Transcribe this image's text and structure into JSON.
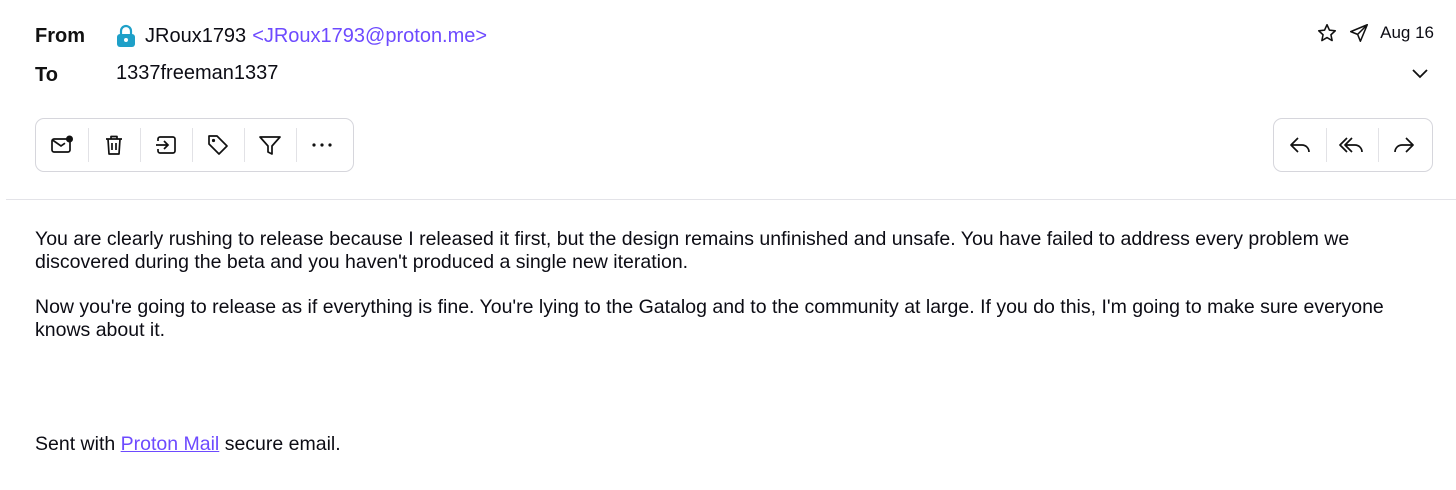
{
  "header": {
    "from_label": "From",
    "to_label": "To",
    "sender_name": "JRoux1793",
    "sender_email": "<JRoux1793@proton.me>",
    "recipient": "1337freeman1337",
    "date": "Aug 16"
  },
  "toolbar_left": [
    {
      "icon": "mark-unread-icon"
    },
    {
      "icon": "trash-icon"
    },
    {
      "icon": "move-to-folder-icon"
    },
    {
      "icon": "label-icon"
    },
    {
      "icon": "filter-icon"
    },
    {
      "icon": "more-icon"
    }
  ],
  "toolbar_right": [
    {
      "icon": "reply-icon"
    },
    {
      "icon": "reply-all-icon"
    },
    {
      "icon": "forward-icon"
    }
  ],
  "body": {
    "paragraph1": "You are clearly rushing to release because I released it first, but the design remains unfinished and unsafe. You have failed to address every problem we discovered during the beta and you haven't produced a single new iteration.",
    "paragraph2": "Now you're going to release as if everything is fine. You're lying to the Gatalog and to the community at large. If you do this, I'm going to make sure everyone knows about it."
  },
  "signature": {
    "prefix": "Sent with",
    "link": "Proton Mail",
    "suffix": "secure email."
  },
  "colors": {
    "accent": "#6d4aff",
    "lock": "#1ea0c8"
  }
}
